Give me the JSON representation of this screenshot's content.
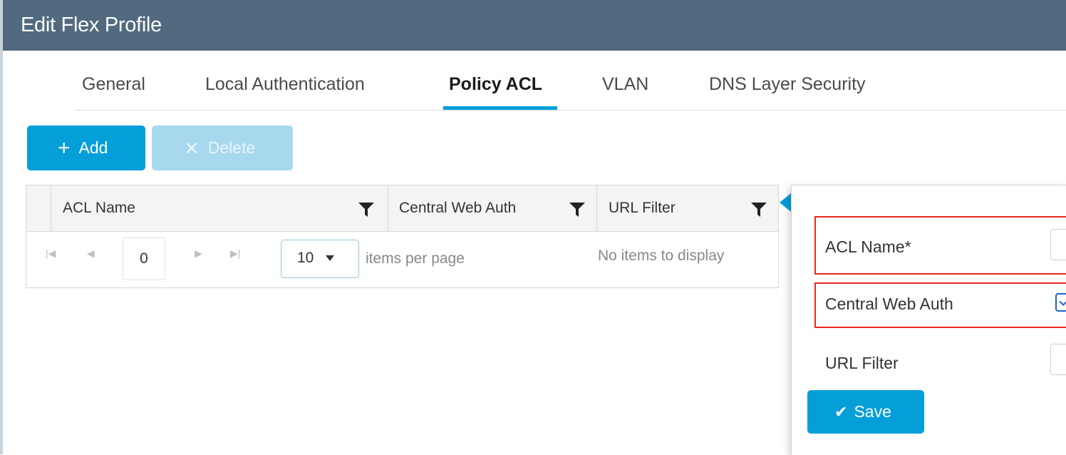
{
  "header": {
    "title": "Edit Flex Profile"
  },
  "tabs": [
    {
      "label": "General"
    },
    {
      "label": "Local Authentication"
    },
    {
      "label": "Policy ACL",
      "active": true
    },
    {
      "label": "VLAN"
    },
    {
      "label": "DNS Layer Security"
    }
  ],
  "toolbar": {
    "add_label": "Add",
    "add_icon": "plus-icon",
    "delete_label": "Delete",
    "delete_icon": "x-icon"
  },
  "grid": {
    "columns": [
      {
        "label": "ACL Name"
      },
      {
        "label": "Central Web Auth"
      },
      {
        "label": "URL Filter"
      }
    ],
    "pager": {
      "page": "0",
      "page_size": "10",
      "items_per_page_label": "items per page",
      "empty_message": "No items to display"
    }
  },
  "panel": {
    "acl_name_label": "ACL Name*",
    "central_web_auth_label": "Central Web Auth",
    "central_web_auth_checked": true,
    "url_filter_label": "URL Filter",
    "save_label": "Save",
    "save_icon": "checkmark-icon"
  },
  "colors": {
    "header_bg": "#526a7f",
    "accent": "#049fd9",
    "highlight_border": "#e8281d"
  }
}
